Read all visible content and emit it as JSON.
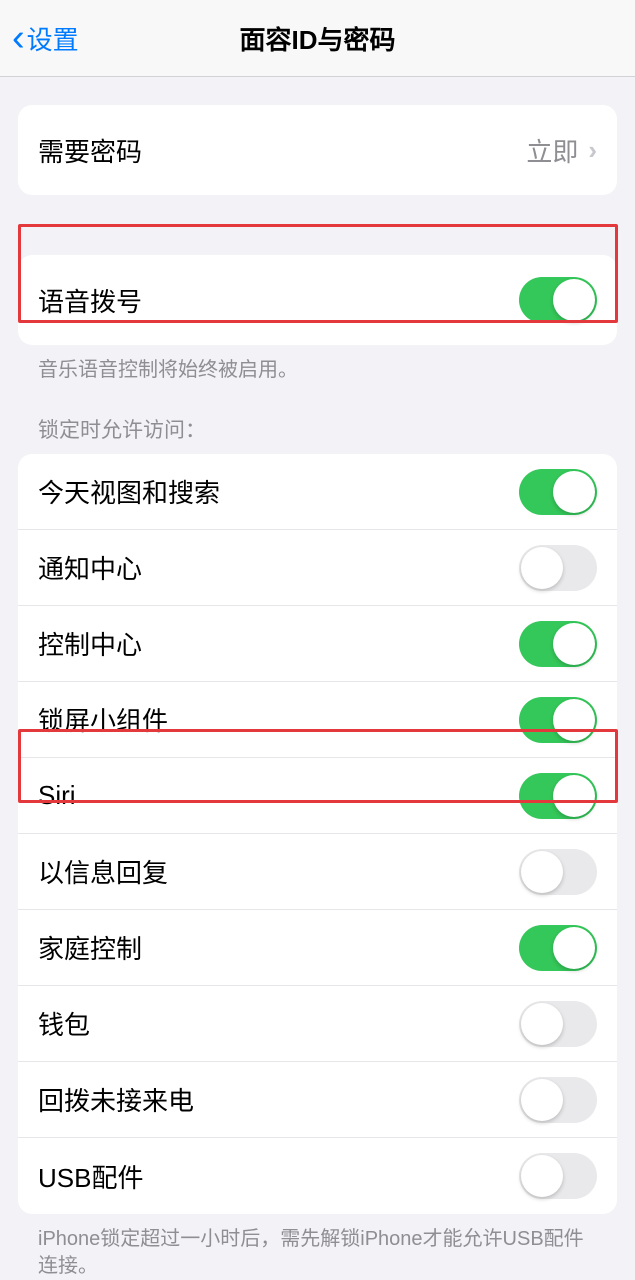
{
  "nav": {
    "back": "设置",
    "title": "面容ID与密码"
  },
  "requirePasscode": {
    "label": "需要密码",
    "value": "立即"
  },
  "voiceDial": {
    "label": "语音拨号",
    "on": true,
    "footer": "音乐语音控制将始终被启用。"
  },
  "lockedAccess": {
    "header": "锁定时允许访问：",
    "items": [
      {
        "label": "今天视图和搜索",
        "on": true
      },
      {
        "label": "通知中心",
        "on": false
      },
      {
        "label": "控制中心",
        "on": true
      },
      {
        "label": "锁屏小组件",
        "on": true
      },
      {
        "label": "Siri",
        "on": true
      },
      {
        "label": "以信息回复",
        "on": false
      },
      {
        "label": "家庭控制",
        "on": true
      },
      {
        "label": "钱包",
        "on": false
      },
      {
        "label": "回拨未接来电",
        "on": false
      },
      {
        "label": "USB配件",
        "on": false
      }
    ],
    "footer": "iPhone锁定超过一小时后，需先解锁iPhone才能允许USB配件连接。"
  }
}
